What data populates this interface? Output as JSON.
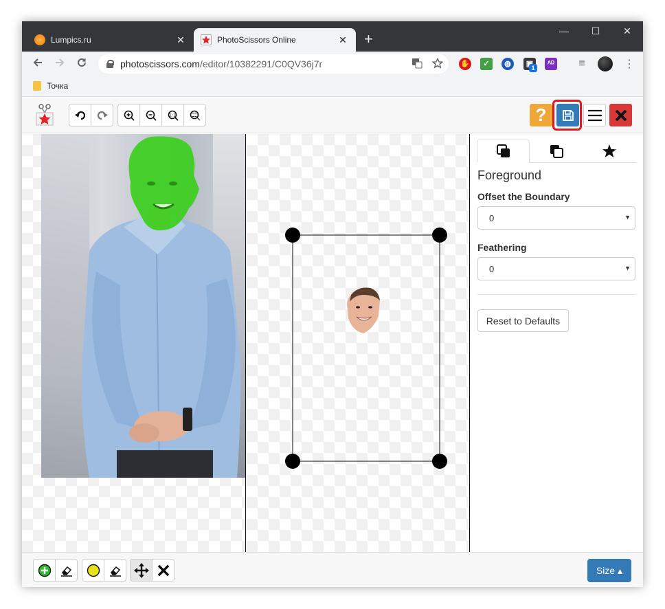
{
  "browser": {
    "tabs": [
      {
        "title": "Lumpics.ru",
        "close": "✕"
      },
      {
        "title": "PhotoScissors Online",
        "close": "✕"
      }
    ],
    "new_tab": "+",
    "window_controls": {
      "minimize": "—",
      "maximize": "☐",
      "close": "✕"
    },
    "url_host": "photoscissors.com",
    "url_path": "/editor/10382291/C0QV36j7r",
    "bookmark": "Точка",
    "extension_badge": "1"
  },
  "app": {
    "help_label": "?",
    "panel": {
      "title": "Foreground",
      "offset_label": "Offset the Boundary",
      "offset_value": "0",
      "feathering_label": "Feathering",
      "feathering_value": "0",
      "reset_label": "Reset to Defaults"
    },
    "size_button": "Size ▴"
  },
  "colors": {
    "accent_blue": "#337ab7",
    "help_orange": "#f0a73a",
    "close_red": "#d9383a",
    "highlight_red": "#e0181f",
    "mask_green": "#3ccf1f"
  }
}
